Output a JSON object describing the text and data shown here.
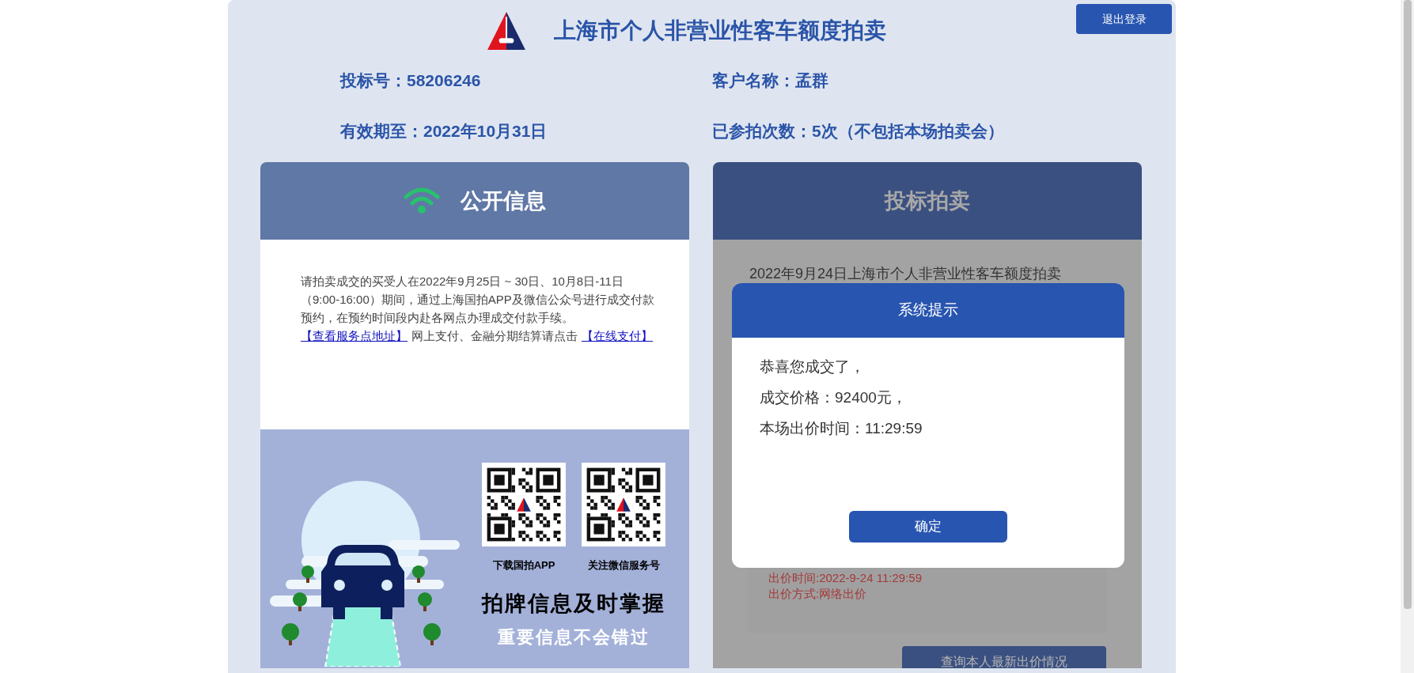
{
  "header": {
    "title": "上海市个人非营业性客车额度拍卖",
    "logout_button": "退出登录"
  },
  "info": [
    "投标号：58206246",
    "客户名称：孟群",
    "有效期至：2022年10月31日",
    "已参拍次数：5次（不包括本场拍卖会）"
  ],
  "public_panel": {
    "title": "公开信息",
    "notice": "请拍卖成交的买受人在2022年9月25日 ~ 30日、10月8日-11日（9:00-16:00）期间，通过上海国拍APP及微信公众号进行成交付款预约，在预约时间段内赴各网点办理成交付款手续。",
    "segments": [
      {
        "kind": "link",
        "text": "【查看服务点地址】"
      },
      {
        "kind": "text",
        "text": "网上支付、金融分期结算请点击"
      },
      {
        "kind": "link",
        "text": "【在线支付】"
      }
    ]
  },
  "promo": {
    "qr_codes": [
      {
        "caption": "下载国拍APP"
      },
      {
        "caption": "关注微信服务号"
      }
    ],
    "headline": "拍牌信息及时掌握",
    "subline": "重要信息不会错过"
  },
  "bidding_panel": {
    "title": "投标拍卖",
    "auction_title": "2022年9月24日上海市个人非营业性客车额度拍卖",
    "bid_lines": [
      "出价时间:2022-9-24 11:29:59",
      "出价方式:网络出价"
    ],
    "query_button": "查询本人最新出价情况"
  },
  "dialog": {
    "title": "系统提示",
    "lines": [
      "恭喜您成交了，",
      "成交价格：92400元，",
      "本场出价时间：11:29:59"
    ],
    "confirm_button": "确定"
  }
}
